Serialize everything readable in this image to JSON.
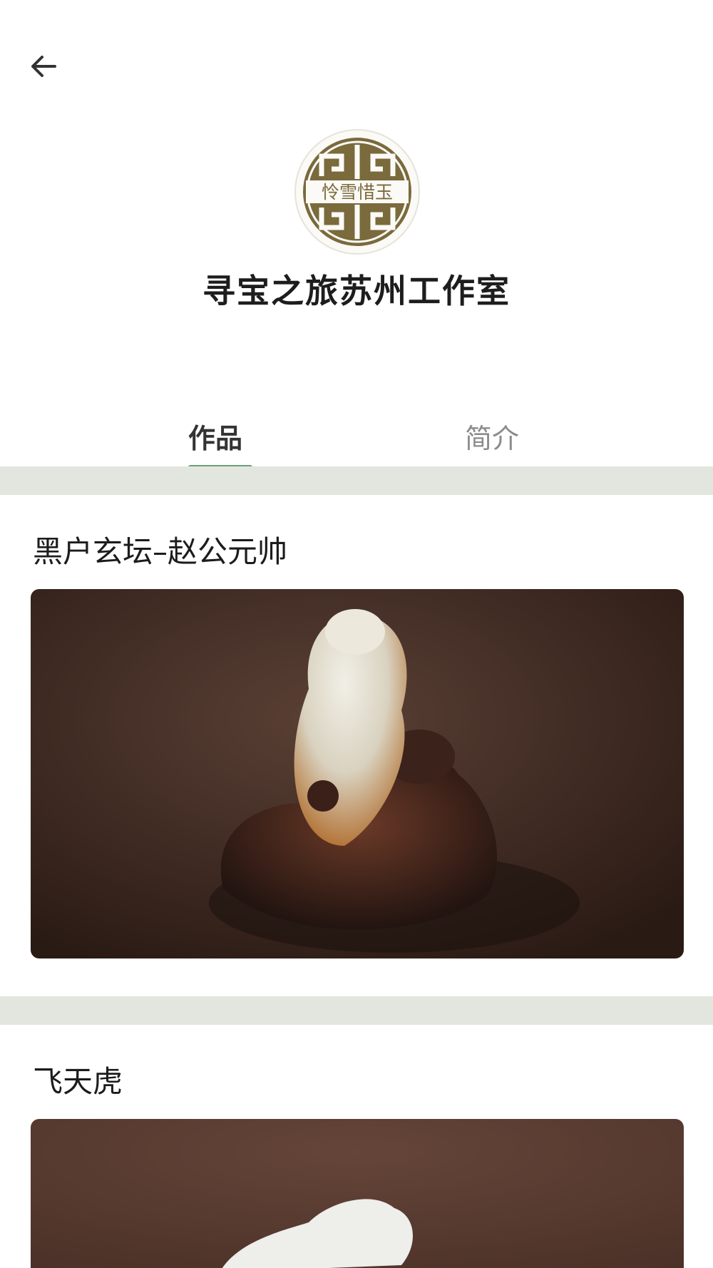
{
  "header": {
    "back_icon": "arrow-left-icon",
    "logo_icon": "studio-logo-seal",
    "logo_text": "怜雪惜玉",
    "studio_name": "寻宝之旅苏州工作室"
  },
  "tabs": [
    {
      "label": "作品",
      "active": true
    },
    {
      "label": "简介",
      "active": false
    }
  ],
  "colors": {
    "accent": "#6f9c78",
    "divider": "#e3e6df",
    "logo_gold": "#7a6a3c"
  },
  "works": [
    {
      "title": "黑户玄坛–赵公元帅",
      "image": "jade-carving-zhao-gongming"
    },
    {
      "title": "飞天虎",
      "image": "jade-carving-flying-tiger"
    }
  ]
}
